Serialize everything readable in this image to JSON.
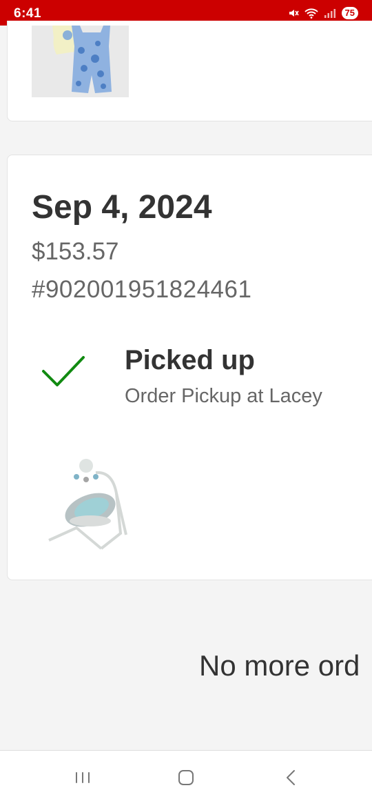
{
  "status_bar": {
    "time": "6:41",
    "battery": "75",
    "color": "#cc0000"
  },
  "icons": [
    "mute-icon",
    "wifi-icon",
    "signal-icon",
    "check-icon",
    "recent-apps-icon",
    "home-icon",
    "back-icon"
  ],
  "order": {
    "date": "Sep 4, 2024",
    "total": "$153.57",
    "number": "#902001951824461",
    "status": "Picked up",
    "location": "Order Pickup at Lacey",
    "status_color": "#118a11"
  },
  "footer": {
    "no_more": "No more ord"
  }
}
